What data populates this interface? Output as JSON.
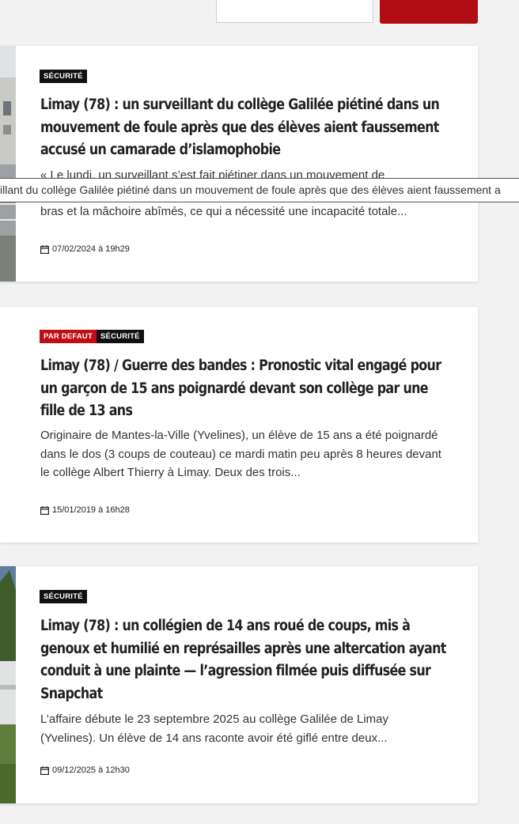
{
  "articles": [
    {
      "categories": [
        "SÉCURITÉ"
      ],
      "category_styles": [
        "dark"
      ],
      "title": "Limay (78) : un surveillant du collège Galilée piétiné dans un mouvement de foule après que des élèves aient faussement accusé un camarade d’islamophobie",
      "excerpt_line1": "« Le lundi, un surveillant s’est fait piétiner dans un mouvement de",
      "excerpt_line3": "bras et la mâchoire abîmés, ce qui a nécessité une incapacité totale...",
      "date": "07/02/2024 à 19h29"
    },
    {
      "categories": [
        "PAR DEFAUT",
        "SÉCURITÉ"
      ],
      "category_styles": [
        "red",
        "dark"
      ],
      "title": "Limay (78) / Guerre des bandes : Pronostic vital engagé pour un garçon de 15 ans poignardé devant son collège par une fille de 13 ans",
      "excerpt": "Originaire de Mantes-la-Ville (Yvelines), un élève de 15 ans a été poignardé dans le dos (3 coups de couteau) ce mardi matin peu après 8 heures devant le collège Albert Thierry à Limay. Deux des trois...",
      "date": "15/01/2019 à 16h28"
    },
    {
      "categories": [
        "SÉCURITÉ"
      ],
      "category_styles": [
        "dark"
      ],
      "title": "Limay (78) : un collégien de 14 ans roué de coups, mis à genoux et humilié en représailles après une altercation ayant conduit à une plainte — l’agression filmée puis diffusée sur Snapchat",
      "excerpt": "L’affaire débute le 23 septembre 2025 au collège Galilée de Limay (Yvelines). Un élève de 14 ans raconte avoir été giflé entre deux...",
      "date": "09/12/2025 à 12h30"
    }
  ],
  "tooltip": "illant du collège Galilée  piétiné dans un mouvement de foule après que des élèves aient faussement a",
  "colors": {
    "accent_red": "#c10d15",
    "badge_dark": "#111111"
  },
  "icons": [
    "calendar-icon"
  ]
}
